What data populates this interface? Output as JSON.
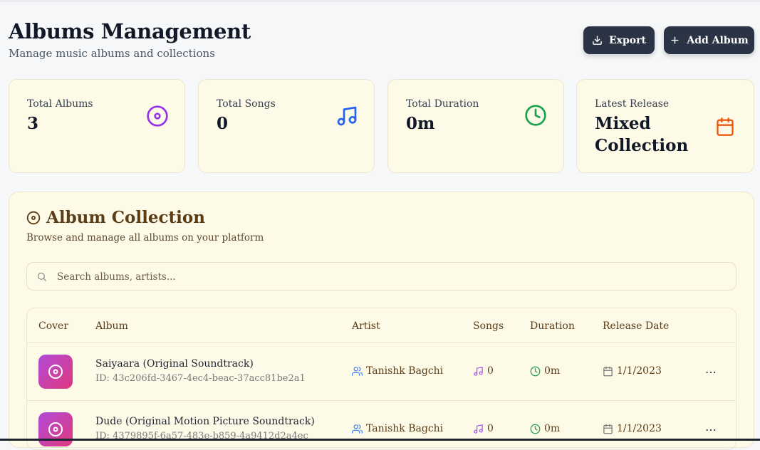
{
  "header": {
    "title": "Albums Management",
    "subtitle": "Manage music albums and collections",
    "export_label": "Export",
    "add_label": "Add Album"
  },
  "stats": [
    {
      "label": "Total Albums",
      "value": "3",
      "icon": "disc-icon",
      "color": "#9333ea"
    },
    {
      "label": "Total Songs",
      "value": "0",
      "icon": "music-icon",
      "color": "#2563eb"
    },
    {
      "label": "Total Duration",
      "value": "0m",
      "icon": "clock-icon",
      "color": "#16a34a"
    },
    {
      "label": "Latest Release",
      "value": "Mixed Collection",
      "icon": "calendar-icon",
      "color": "#ea580c"
    }
  ],
  "collection": {
    "title": "Album Collection",
    "subtitle": "Browse and manage all albums on your platform",
    "search_placeholder": "Search albums, artists...",
    "columns": [
      "Cover",
      "Album",
      "Artist",
      "Songs",
      "Duration",
      "Release Date"
    ],
    "rows": [
      {
        "album": "Saiyaara (Original Soundtrack)",
        "id": "ID: 43c206fd-3467-4ec4-beac-37acc81be2a1",
        "artist": "Tanishk Bagchi",
        "songs": "0",
        "duration": "0m",
        "release": "1/1/2023"
      },
      {
        "album": "Dude (Original Motion Picture Soundtrack)",
        "id": "ID: 4379895f-6a57-483e-b859-4a9412d2a4ec",
        "artist": "Tanishk Bagchi",
        "songs": "0",
        "duration": "0m",
        "release": "1/1/2023"
      }
    ]
  },
  "colors": {
    "button_bg": "#2b3444",
    "card_bg": "#fefae8",
    "accent_brown": "#5b3d17",
    "cover_gradient_start": "#b04bd8",
    "cover_gradient_end": "#e0387d"
  }
}
